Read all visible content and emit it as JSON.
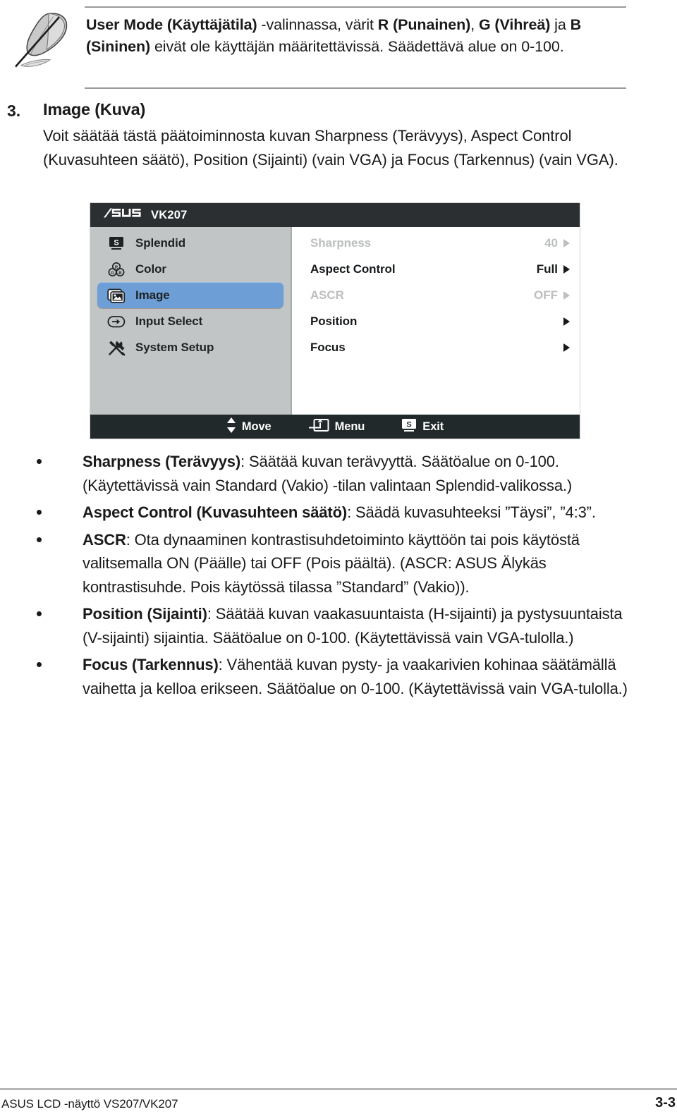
{
  "note": {
    "icon": "feather-quill-icon",
    "text_html": "<b>User Mode (Käyttäjätila)</b> -valinnassa, värit <b>R (Punainen)</b>, <b>G (Vihreä)</b> ja <b>B (Sininen)</b> eivät ole käyttäjän määritettävissä. Säädettävä alue on 0-100."
  },
  "section": {
    "number": "3.",
    "title": "Image (Kuva)",
    "body": "Voit säätää tästä päätoiminnosta kuvan Sharpness (Terävyys), Aspect Control (Kuvasuhteen säätö), Position (Sijainti) (vain VGA) ja Focus (Tarkennus) (vain VGA)."
  },
  "osd": {
    "brand": "ASUS",
    "model": "VK207",
    "colors": {
      "titlebar": "#2b2f31",
      "sidebar": "#c2c5c6",
      "highlight": "#6e9ed6",
      "footerbar": "#22292b",
      "dim_text": "#bcbec0"
    },
    "sidebar_items": [
      {
        "label": "Splendid",
        "icon": "splendid-s-icon",
        "selected": false
      },
      {
        "label": "Color",
        "icon": "color-rgb-icon",
        "selected": false
      },
      {
        "label": "Image",
        "icon": "image-picture-icon",
        "selected": true
      },
      {
        "label": "Input Select",
        "icon": "input-arrow-icon",
        "selected": false
      },
      {
        "label": "System Setup",
        "icon": "tools-icon",
        "selected": false
      }
    ],
    "rows": [
      {
        "label": "Sharpness",
        "value": "40",
        "dim": true,
        "arrow": true
      },
      {
        "label": "Aspect Control",
        "value": "Full",
        "dim": false,
        "arrow": true
      },
      {
        "label": "ASCR",
        "value": "OFF",
        "dim": true,
        "arrow": true
      },
      {
        "label": "Position",
        "value": "",
        "dim": false,
        "arrow": true
      },
      {
        "label": "Focus",
        "value": "",
        "dim": false,
        "arrow": true
      }
    ],
    "hints": [
      {
        "label": "Move",
        "icon": "up-down-arrows-icon"
      },
      {
        "label": "Menu",
        "icon": "menu-enter-icon"
      },
      {
        "label": "Exit",
        "icon": "splendid-s-icon"
      }
    ]
  },
  "bullets": [
    {
      "term": "Sharpness (Terävyys)",
      "desc": ": Säätää kuvan terävyyttä. Säätöalue on 0-100. (Käytettävissä vain Standard (Vakio) -tilan valintaan Splendid-valikossa.)"
    },
    {
      "term": "Aspect Control (Kuvasuhteen säätö)",
      "desc": ": Säädä kuvasuhteeksi ”Täysi”, ”4:3”."
    },
    {
      "term": "ASCR",
      "desc": ": Ota dynaaminen kontrastisuhdetoiminto käyttöön tai pois käytöstä valitsemalla ON (Päälle) tai OFF (Pois päältä). (ASCR: ASUS Älykäs kontrastisuhde. Pois käytössä tilassa ”Standard” (Vakio))."
    },
    {
      "term": "Position (Sijainti)",
      "desc": ": Säätää kuvan vaakasuuntaista (H-sijainti) ja pystysuuntaista (V-sijainti) sijaintia. Säätöalue on 0-100. (Käytettävissä vain VGA-tulolla.)"
    },
    {
      "term": "Focus (Tarkennus)",
      "desc": ": Vähentää kuvan pysty- ja vaakarivien kohinaa säätämällä vaihetta ja kelloa erikseen. Säätöalue on 0-100. (Käytettävissä vain VGA-tulolla.)"
    }
  ],
  "footer": {
    "left": "ASUS LCD -näyttö VS207/VK207",
    "page": "3-3"
  }
}
